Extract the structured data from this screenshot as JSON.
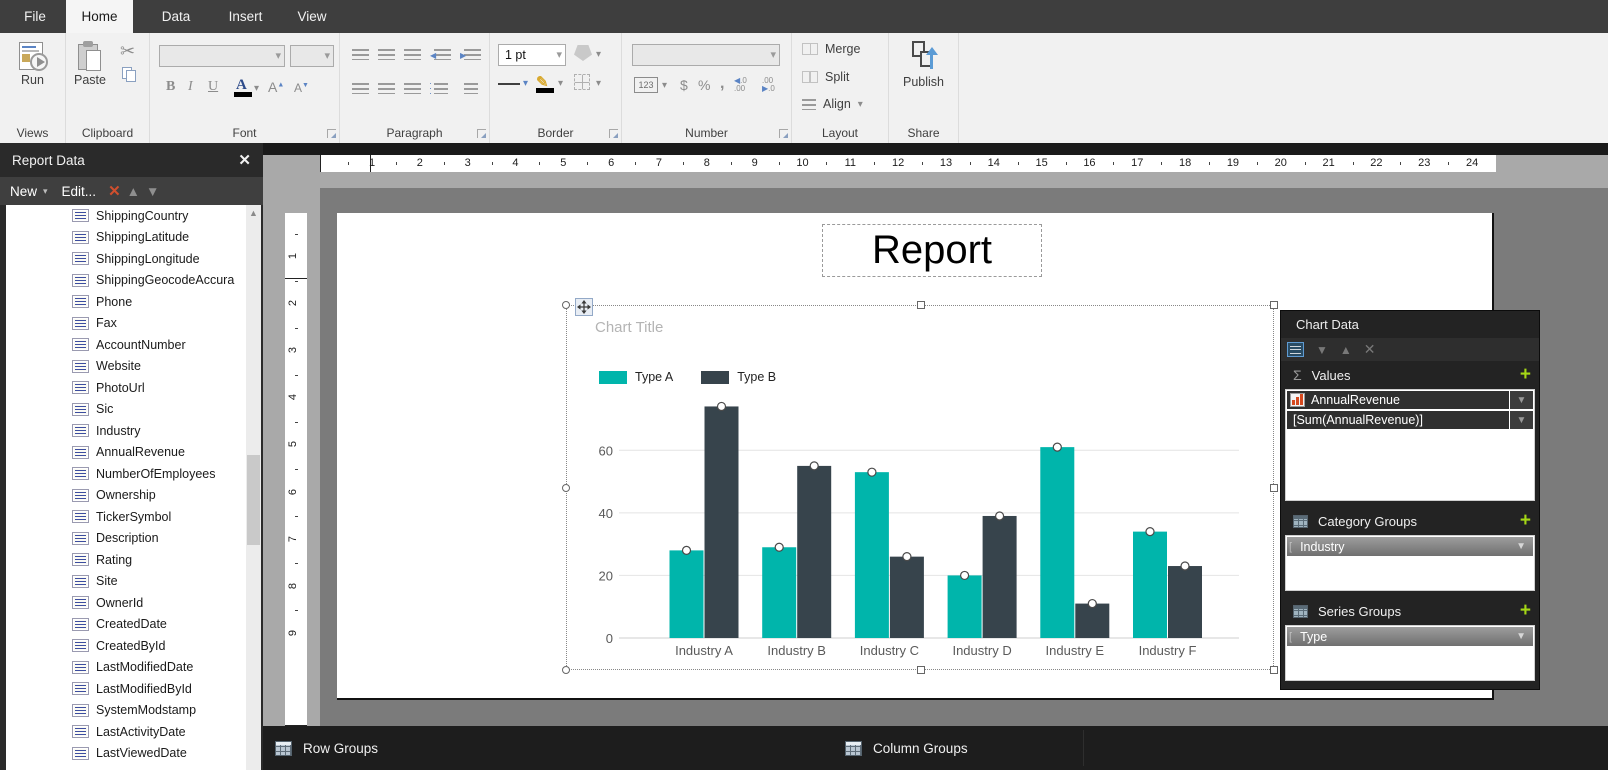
{
  "titlebar": {
    "tabs": [
      {
        "label": "File",
        "active": false
      },
      {
        "label": "Home",
        "active": true
      },
      {
        "label": "Data",
        "active": false
      },
      {
        "label": "Insert",
        "active": false
      },
      {
        "label": "View",
        "active": false
      }
    ]
  },
  "ribbon": {
    "views": {
      "label": "Views",
      "run": "Run"
    },
    "clipboard": {
      "label": "Clipboard",
      "paste": "Paste"
    },
    "font": {
      "label": "Font",
      "bold": "B",
      "italic": "I",
      "underline": "U",
      "color_letter": "A"
    },
    "paragraph": {
      "label": "Paragraph"
    },
    "border": {
      "label": "Border",
      "width_value": "1 pt",
      "number_badge": "123"
    },
    "number": {
      "label": "Number",
      "dollar": "$",
      "percent": "%",
      "comma": ","
    },
    "layout": {
      "label": "Layout",
      "merge": "Merge",
      "split": "Split",
      "align": "Align"
    },
    "share": {
      "label": "Share",
      "publish": "Publish"
    }
  },
  "report_data_panel": {
    "title": "Report Data",
    "new_button": "New",
    "edit_button": "Edit...",
    "fields": [
      "ShippingCountry",
      "ShippingLatitude",
      "ShippingLongitude",
      "ShippingGeocodeAccura",
      "Phone",
      "Fax",
      "AccountNumber",
      "Website",
      "PhotoUrl",
      "Sic",
      "Industry",
      "AnnualRevenue",
      "NumberOfEmployees",
      "Ownership",
      "TickerSymbol",
      "Description",
      "Rating",
      "Site",
      "OwnerId",
      "CreatedDate",
      "CreatedById",
      "LastModifiedDate",
      "LastModifiedById",
      "SystemModstamp",
      "LastActivityDate",
      "LastViewedDate"
    ]
  },
  "canvas": {
    "report_title": "Report"
  },
  "chart_data": {
    "type": "bar",
    "title": "Chart Title",
    "categories": [
      "Industry A",
      "Industry B",
      "Industry C",
      "Industry D",
      "Industry E",
      "Industry F"
    ],
    "series": [
      {
        "name": "Type A",
        "color": "#00B5AB",
        "values": [
          28,
          29,
          53,
          20,
          61,
          34
        ]
      },
      {
        "name": "Type B",
        "color": "#37444C",
        "values": [
          74,
          55,
          26,
          39,
          11,
          23
        ]
      }
    ],
    "yticks": [
      0,
      20,
      40,
      60
    ],
    "ylim": [
      0,
      80
    ],
    "grid": true,
    "legend_position": "top-left",
    "xlabel": "",
    "ylabel": ""
  },
  "chart_data_panel": {
    "title": "Chart Data",
    "values_section": {
      "label": "Values",
      "field": "AnnualRevenue",
      "expression": "[Sum(AnnualRevenue)]"
    },
    "category_section": {
      "label": "Category Groups",
      "item": "Industry"
    },
    "series_section": {
      "label": "Series Groups",
      "item": "Type"
    }
  },
  "grouping_pane": {
    "row_groups": "Row Groups",
    "column_groups": "Column Groups"
  },
  "rulers": {
    "horizontal": [
      1,
      2,
      3,
      4,
      5,
      6,
      7,
      8,
      9,
      10,
      11,
      12,
      13,
      14,
      15,
      16,
      17,
      18,
      19,
      20,
      21,
      22,
      23,
      24
    ],
    "vertical": [
      1,
      2,
      3,
      4,
      5,
      6,
      7,
      8,
      9
    ]
  },
  "colors": {
    "accent_teal": "#00B5AB",
    "accent_dark": "#37444C",
    "plus_green": "#A5D716",
    "delete_red": "#D14F2E"
  }
}
